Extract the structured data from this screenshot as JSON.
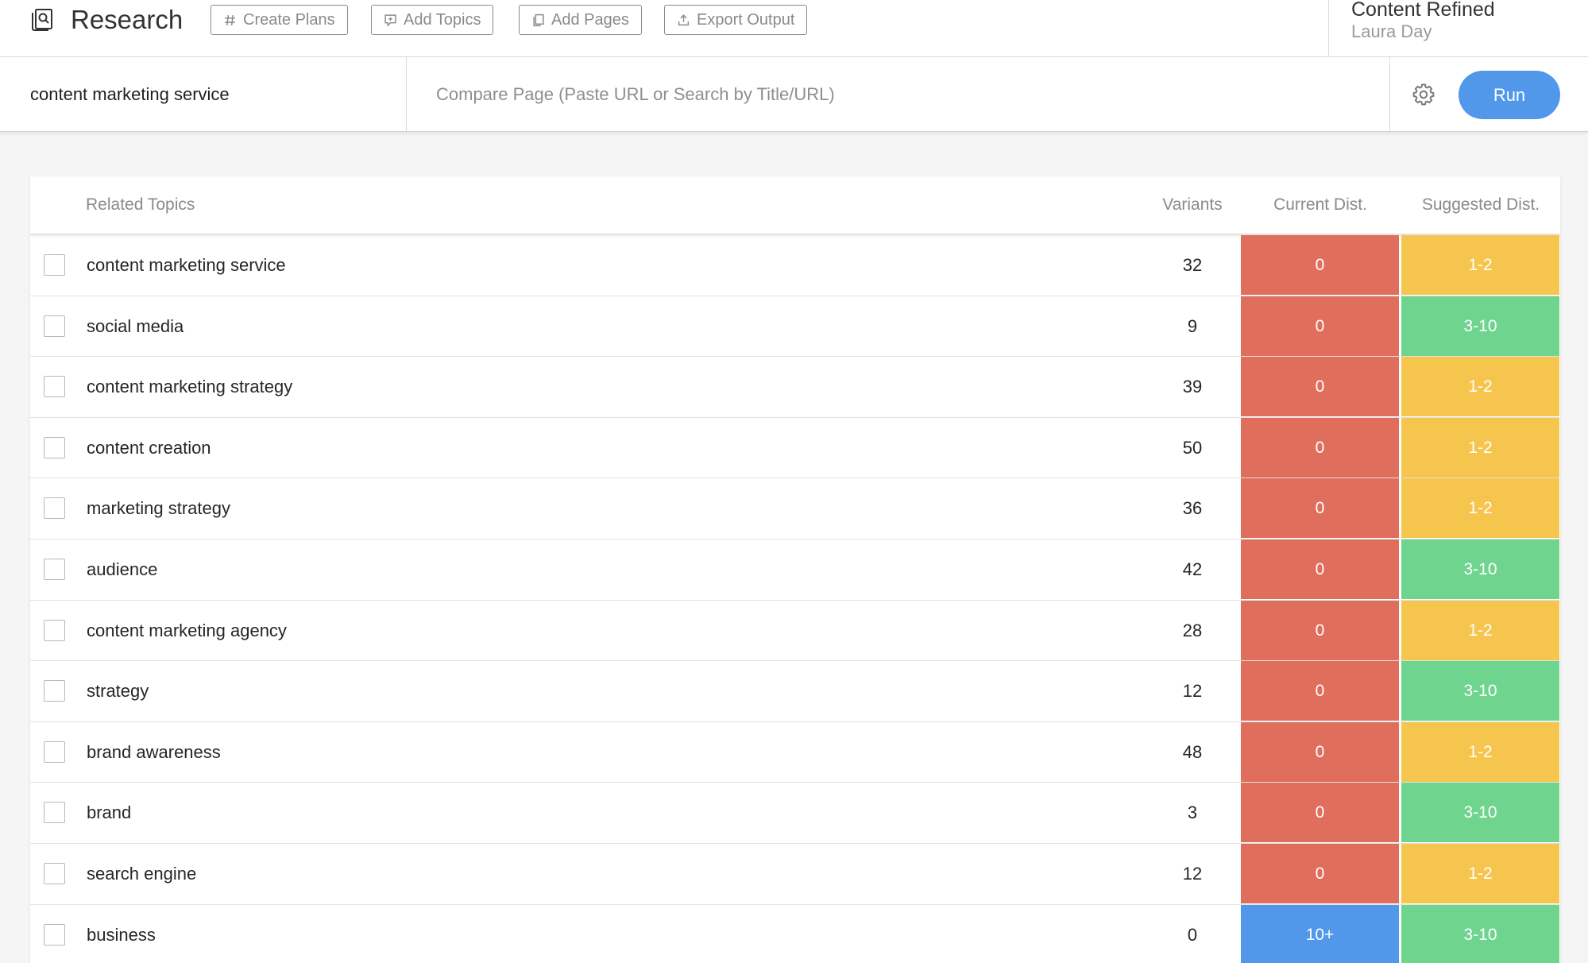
{
  "header": {
    "app_title": "Research",
    "tool_buttons": [
      {
        "label": "Create Plans",
        "icon": "hash-icon"
      },
      {
        "label": "Add Topics",
        "icon": "comment-icon"
      },
      {
        "label": "Add Pages",
        "icon": "pages-icon"
      },
      {
        "label": "Export Output",
        "icon": "upload-icon"
      }
    ],
    "project_name": "Content Refined",
    "user_name": "Laura Day"
  },
  "search": {
    "keyword": "content marketing service",
    "compare_placeholder": "Compare Page (Paste URL or Search by Title/URL)",
    "run_label": "Run"
  },
  "colors": {
    "red": "#df6e5d",
    "yellow": "#f5c54e",
    "green": "#6ed48e",
    "blue": "#5197ea"
  },
  "table": {
    "headers": {
      "topic": "Related Topics",
      "variants": "Variants",
      "current": "Current Dist.",
      "suggested": "Suggested Dist."
    },
    "rows": [
      {
        "topic": "content marketing service",
        "variants": "32",
        "current": "0",
        "current_color": "red",
        "suggested": "1-2",
        "suggested_color": "yellow"
      },
      {
        "topic": "social media",
        "variants": "9",
        "current": "0",
        "current_color": "red",
        "suggested": "3-10",
        "suggested_color": "green"
      },
      {
        "topic": "content marketing strategy",
        "variants": "39",
        "current": "0",
        "current_color": "red",
        "suggested": "1-2",
        "suggested_color": "yellow"
      },
      {
        "topic": "content creation",
        "variants": "50",
        "current": "0",
        "current_color": "red",
        "suggested": "1-2",
        "suggested_color": "yellow"
      },
      {
        "topic": "marketing strategy",
        "variants": "36",
        "current": "0",
        "current_color": "red",
        "suggested": "1-2",
        "suggested_color": "yellow"
      },
      {
        "topic": "audience",
        "variants": "42",
        "current": "0",
        "current_color": "red",
        "suggested": "3-10",
        "suggested_color": "green"
      },
      {
        "topic": "content marketing agency",
        "variants": "28",
        "current": "0",
        "current_color": "red",
        "suggested": "1-2",
        "suggested_color": "yellow"
      },
      {
        "topic": "strategy",
        "variants": "12",
        "current": "0",
        "current_color": "red",
        "suggested": "3-10",
        "suggested_color": "green"
      },
      {
        "topic": "brand awareness",
        "variants": "48",
        "current": "0",
        "current_color": "red",
        "suggested": "1-2",
        "suggested_color": "yellow"
      },
      {
        "topic": "brand",
        "variants": "3",
        "current": "0",
        "current_color": "red",
        "suggested": "3-10",
        "suggested_color": "green"
      },
      {
        "topic": "search engine",
        "variants": "12",
        "current": "0",
        "current_color": "red",
        "suggested": "1-2",
        "suggested_color": "yellow"
      },
      {
        "topic": "business",
        "variants": "0",
        "current": "10+",
        "current_color": "blue",
        "suggested": "3-10",
        "suggested_color": "green"
      }
    ]
  }
}
